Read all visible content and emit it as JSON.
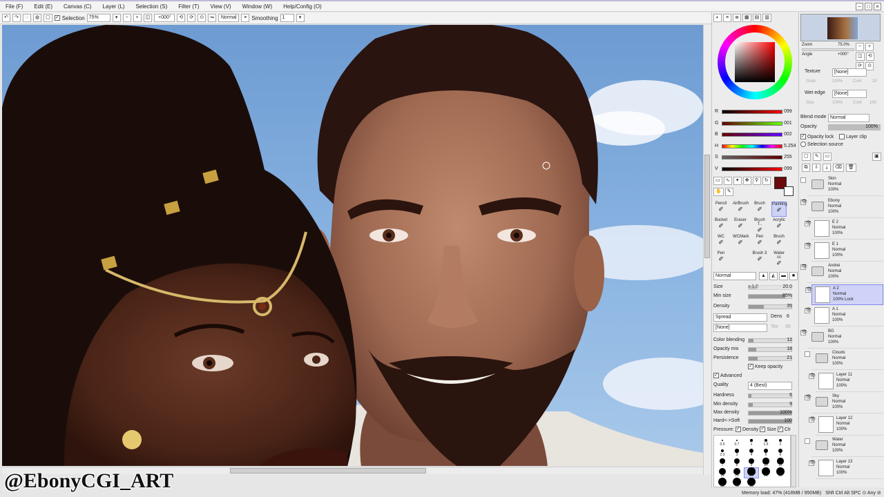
{
  "menu": [
    "File (F)",
    "Edit (E)",
    "Canvas (C)",
    "Layer (L)",
    "Selection (S)",
    "Filter (T)",
    "View (V)",
    "Window (W)",
    "Help/Config (O)"
  ],
  "toolbar": {
    "selection_label": "Selection",
    "zoom": "75%",
    "angle": "+000°",
    "blend": "Normal",
    "smoothing_label": "Smoothing",
    "smoothing_value": "1"
  },
  "watermark": "@EbonyCGI_ART",
  "status": {
    "memory": "Memory load: 47% (418MB / 950MB)",
    "keys": "Shft Ctrl Alt SPC ⊙ Any ⊘"
  },
  "navigator": {
    "zoom_label": "Zoom",
    "zoom_value": "75.0%",
    "angle_label": "Angle",
    "angle_value": "+000°"
  },
  "color": {
    "current": "#6b0a0a",
    "channels": [
      {
        "label": "R",
        "value": "099",
        "gradient": "linear-gradient(90deg,#000,#ff0000)"
      },
      {
        "label": "G",
        "value": "001",
        "gradient": "linear-gradient(90deg,#630000,#63ff00)"
      },
      {
        "label": "B",
        "value": "002",
        "gradient": "linear-gradient(90deg,#630100,#6301ff)"
      },
      {
        "label": "H",
        "value": "5.254",
        "gradient": "linear-gradient(90deg,red,yellow,lime,cyan,blue,magenta,red)"
      },
      {
        "label": "S",
        "value": "255",
        "gradient": "linear-gradient(90deg,#636363,#630000)"
      },
      {
        "label": "V",
        "value": "099",
        "gradient": "linear-gradient(90deg,#000,#ff0000)"
      }
    ]
  },
  "tools": [
    [
      "Pencil",
      "AirBrush",
      "Brush",
      "Painting"
    ],
    [
      "Bucket",
      "Eraser",
      "Brush T..",
      "Acrylic"
    ],
    [
      "WC",
      "WCMark",
      "Pen",
      "Brush"
    ],
    [
      "Pen",
      "",
      "Brush 3",
      "Water cc"
    ]
  ],
  "brush": {
    "blend": "Normal",
    "size_label": "Size",
    "size_mult": "x 1.0",
    "size_value": "20.0",
    "minsize_label": "Min size",
    "minsize_value": "85%",
    "density_label": "Density",
    "density_value": "35",
    "spread": "Spread",
    "dens_label": "Dens",
    "dens_value": "6",
    "none": "[None]",
    "tex_label": "Tex",
    "tex_value": "95",
    "color_blending_label": "Color blending",
    "color_blending": "12",
    "opacity_mix_label": "Opacity mix",
    "opacity_mix": "18",
    "persistence_label": "Persistence",
    "persistence": "21",
    "keep_opacity": "Keep opacity",
    "advanced": "Advanced",
    "quality_label": "Quality",
    "quality": "4 (Best)",
    "hardness_label": "Hardness",
    "hardness": "6",
    "min_density_label": "Min density",
    "min_density": "9",
    "max_density_label": "Max density",
    "max_density": "100%",
    "hardsoft_label": "Hard<->Soft",
    "hardsoft": "100",
    "pressure_label": "Pressure:",
    "pressure_density": "Density",
    "pressure_size": "Size",
    "pressure_clr": "Clr"
  },
  "brush_sizes": [
    "0.5",
    "0.7",
    "1",
    "1.5",
    "2",
    "2.3",
    "3",
    "4",
    "5",
    "6",
    "7",
    "8",
    "9",
    "10",
    "12",
    "14",
    "16",
    "20",
    "25",
    "30",
    "35",
    "40",
    "50"
  ],
  "layer_props": {
    "texture_label": "Texture",
    "texture": "[None]",
    "grain": "Grain",
    "grain_val": "100%",
    "cont": "Cont",
    "cont_val": "20",
    "wet_edge_label": "Wet edge",
    "wet_edge": "[None]",
    "size": "Size",
    "size_val": "100%",
    "cont_val2": "100",
    "blend_mode_label": "Blend mode",
    "blend_mode": "Normal",
    "opacity_label": "Opacity",
    "opacity": "100%",
    "opacity_lock": "Opacity lock",
    "layer_clip": "Layer clip",
    "selection_source": "Selection source"
  },
  "layers": [
    {
      "name": "Skin",
      "mode": "Normal",
      "opacity": "100%",
      "kind": "folder",
      "indent": 0,
      "visible": false
    },
    {
      "name": "Ebony",
      "mode": "Normal",
      "opacity": "100%",
      "kind": "folder",
      "indent": 0,
      "visible": true
    },
    {
      "name": "E 2",
      "mode": "Normal",
      "opacity": "100%",
      "kind": "image",
      "indent": 1,
      "visible": true
    },
    {
      "name": "E 1",
      "mode": "Normal",
      "opacity": "100%",
      "kind": "image",
      "indent": 1,
      "visible": true
    },
    {
      "name": "Andrei",
      "mode": "Normal",
      "opacity": "100%",
      "kind": "folder",
      "indent": 0,
      "visible": true
    },
    {
      "name": "A 2",
      "mode": "Normal",
      "opacity": "100% Lock",
      "kind": "image",
      "indent": 1,
      "visible": true,
      "selected": true
    },
    {
      "name": "A 1",
      "mode": "Normal",
      "opacity": "100%",
      "kind": "image",
      "indent": 1,
      "visible": true
    },
    {
      "name": "BG",
      "mode": "Normal",
      "opacity": "100%",
      "kind": "folder",
      "indent": 0,
      "visible": true
    },
    {
      "name": "Clouds",
      "mode": "Normal",
      "opacity": "100%",
      "kind": "folder",
      "indent": 1,
      "visible": false
    },
    {
      "name": "Layer 11",
      "mode": "Normal",
      "opacity": "100%",
      "kind": "image",
      "indent": 2,
      "visible": true
    },
    {
      "name": "Sky",
      "mode": "Normal",
      "opacity": "100%",
      "kind": "folder",
      "indent": 1,
      "visible": true
    },
    {
      "name": "Layer 12",
      "mode": "Normal",
      "opacity": "100%",
      "kind": "image",
      "indent": 2,
      "visible": true
    },
    {
      "name": "Water",
      "mode": "Normal",
      "opacity": "100%",
      "kind": "folder",
      "indent": 1,
      "visible": false
    },
    {
      "name": "Layer 13",
      "mode": "Normal",
      "opacity": "100%",
      "kind": "image",
      "indent": 2,
      "visible": true
    }
  ]
}
